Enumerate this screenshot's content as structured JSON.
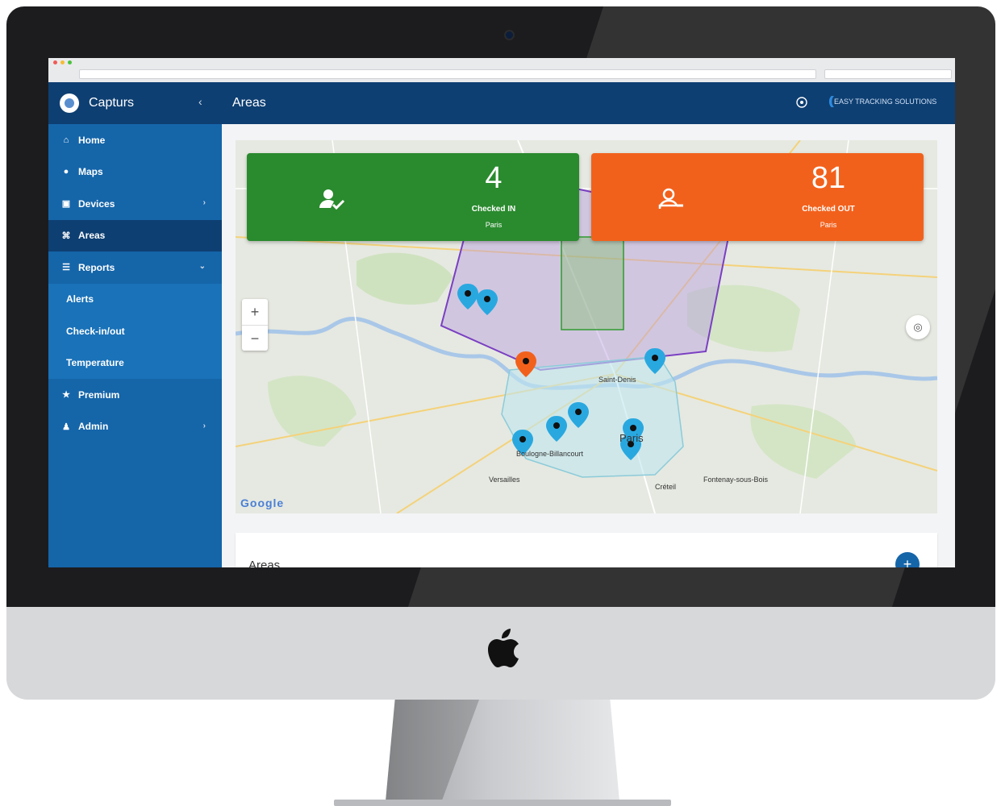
{
  "app": {
    "name": "Capturs",
    "brand_tagline": "EASY TRACKING SOLUTIONS"
  },
  "header": {
    "title": "Areas"
  },
  "sidebar": {
    "items": [
      {
        "label": "Home",
        "icon": "home-icon"
      },
      {
        "label": "Maps",
        "icon": "map-pin-icon"
      },
      {
        "label": "Devices",
        "icon": "devices-icon"
      },
      {
        "label": "Areas",
        "icon": "areas-icon",
        "active": true
      },
      {
        "label": "Reports",
        "icon": "list-icon"
      },
      {
        "label": "Premium",
        "icon": "star-icon"
      },
      {
        "label": "Admin",
        "icon": "user-icon"
      }
    ],
    "reports_sub": [
      {
        "label": "Alerts"
      },
      {
        "label": "Check-in/out"
      },
      {
        "label": "Temperature"
      }
    ]
  },
  "stats": {
    "checked_in": {
      "value": "4",
      "label": "Checked IN",
      "sub": "Paris",
      "color": "#2a8a2e"
    },
    "checked_out": {
      "value": "81",
      "label": "Checked OUT",
      "sub": "Paris",
      "color": "#f2611c"
    }
  },
  "map": {
    "labels": {
      "paris": "Paris",
      "boulogne": "Boulogne-Billancourt",
      "creteil": "Créteil",
      "vincennes": "Fontenay-sous-Bois",
      "versailles": "Versailles",
      "saint_denis": "Saint-Denis",
      "google": "Google"
    },
    "zoom_in": "+",
    "zoom_out": "−"
  },
  "areas_section": {
    "title": "Areas",
    "add": "+"
  },
  "colors": {
    "sidebar": "#1565a9",
    "header": "#0e3f72",
    "accent_green": "#2a8a2e",
    "accent_orange": "#f2611c"
  }
}
